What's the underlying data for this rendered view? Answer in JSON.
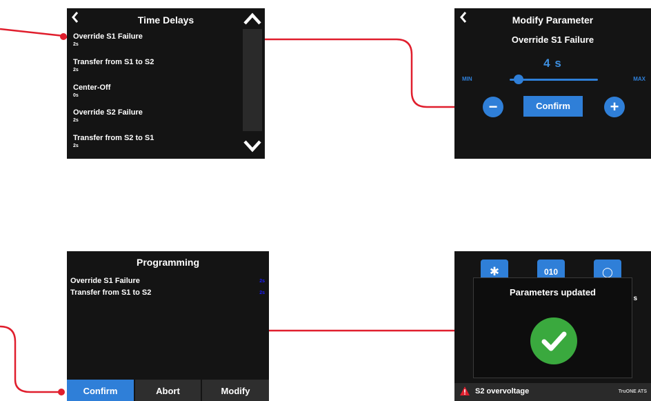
{
  "time_delays": {
    "title": "Time Delays",
    "items": [
      {
        "name": "Override S1 Failure",
        "value": "2s"
      },
      {
        "name": "Transfer from S1 to S2",
        "value": "2s"
      },
      {
        "name": "Center-Off",
        "value": "0s"
      },
      {
        "name": "Override S2 Failure",
        "value": "2s"
      },
      {
        "name": "Transfer from S2 to S1",
        "value": "2s"
      }
    ]
  },
  "modify_parameter": {
    "title": "Modify Parameter",
    "parameter": "Override S1 Failure",
    "value": "4 s",
    "min_label": "MIN",
    "max_label": "MAX",
    "minus": "−",
    "plus": "+",
    "confirm": "Confirm",
    "slider_fraction": 0.1
  },
  "programming": {
    "title": "Programming",
    "rows": [
      {
        "name": "Override S1 Failure",
        "value": "2s"
      },
      {
        "name": "Transfer from S1 to S2",
        "value": "2s"
      }
    ],
    "buttons": {
      "confirm": "Confirm",
      "abort": "Abort",
      "modify": "Modify"
    }
  },
  "result": {
    "background_icon_glyphs": [
      "✱",
      "010",
      "◯"
    ],
    "clipped_text": "s",
    "modal_title": "Parameters updated",
    "status_text": "S2 overvoltage",
    "brand": "TruONE ATS"
  },
  "colors": {
    "accent": "#2f7fd8",
    "connector": "#e01e2d",
    "success": "#3aa93e",
    "warning": "#e01e2d"
  },
  "icons": [
    "back-arrow-icon",
    "chevron-up-icon",
    "chevron-down-icon",
    "minus-icon",
    "plus-icon",
    "checkmark-icon",
    "warning-icon",
    "gear-icon"
  ]
}
